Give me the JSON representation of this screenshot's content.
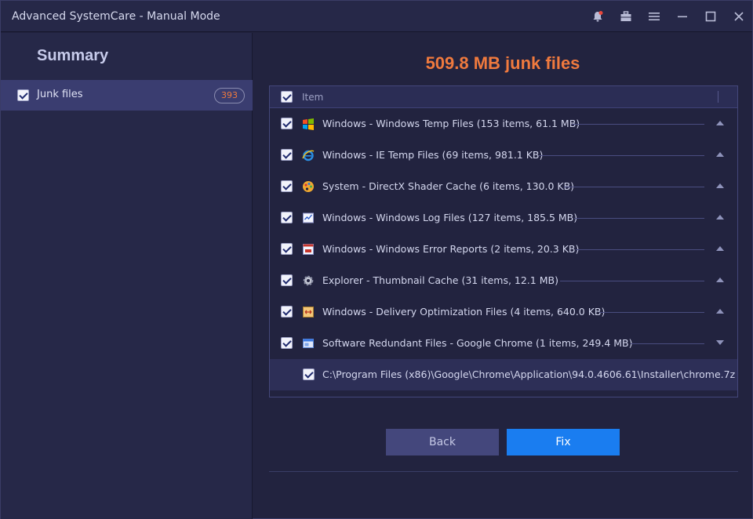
{
  "window": {
    "title": "Advanced SystemCare - Manual Mode",
    "controls": [
      "notification-icon",
      "toolbox-icon",
      "menu-icon",
      "minimize-icon",
      "maximize-icon",
      "close-icon"
    ]
  },
  "sidebar": {
    "title": "Summary",
    "items": [
      {
        "label": "Junk files",
        "count": "393",
        "checked": true
      }
    ]
  },
  "main": {
    "headline": "509.8 MB junk files",
    "list_header": "Item",
    "rows": [
      {
        "icon": "windows-flag-icon",
        "label": "Windows - Windows Temp Files (153 items, 61.1 MB)",
        "checked": true,
        "expanded": false
      },
      {
        "icon": "ie-icon",
        "label": "Windows - IE Temp Files (69 items, 981.1 KB)",
        "checked": true,
        "expanded": false
      },
      {
        "icon": "palette-icon",
        "label": "System - DirectX Shader Cache (6 items, 130.0 KB)",
        "checked": true,
        "expanded": false
      },
      {
        "icon": "log-icon",
        "label": "Windows - Windows Log Files (127 items, 185.5 MB)",
        "checked": true,
        "expanded": false
      },
      {
        "icon": "error-report-icon",
        "label": "Windows - Windows Error Reports (2 items, 20.3 KB)",
        "checked": true,
        "expanded": false
      },
      {
        "icon": "gear-icon",
        "label": "Explorer - Thumbnail Cache (31 items, 12.1 MB)",
        "checked": true,
        "expanded": false
      },
      {
        "icon": "delivery-icon",
        "label": "Windows - Delivery Optimization Files (4 items, 640.0 KB)",
        "checked": true,
        "expanded": false
      },
      {
        "icon": "software-window-icon",
        "label": "Software Redundant Files - Google Chrome (1 items, 249.4 MB)",
        "checked": true,
        "expanded": true
      }
    ],
    "subrow": {
      "label": "C:\\Program Files (x86)\\Google\\Chrome\\Application\\94.0.4606.61\\Installer\\chrome.7z",
      "checked": true
    },
    "buttons": {
      "back": "Back",
      "fix": "Fix"
    }
  },
  "colors": {
    "accent": "#f07a3e",
    "primary_button": "#1a7df0",
    "background": "#22233f"
  }
}
